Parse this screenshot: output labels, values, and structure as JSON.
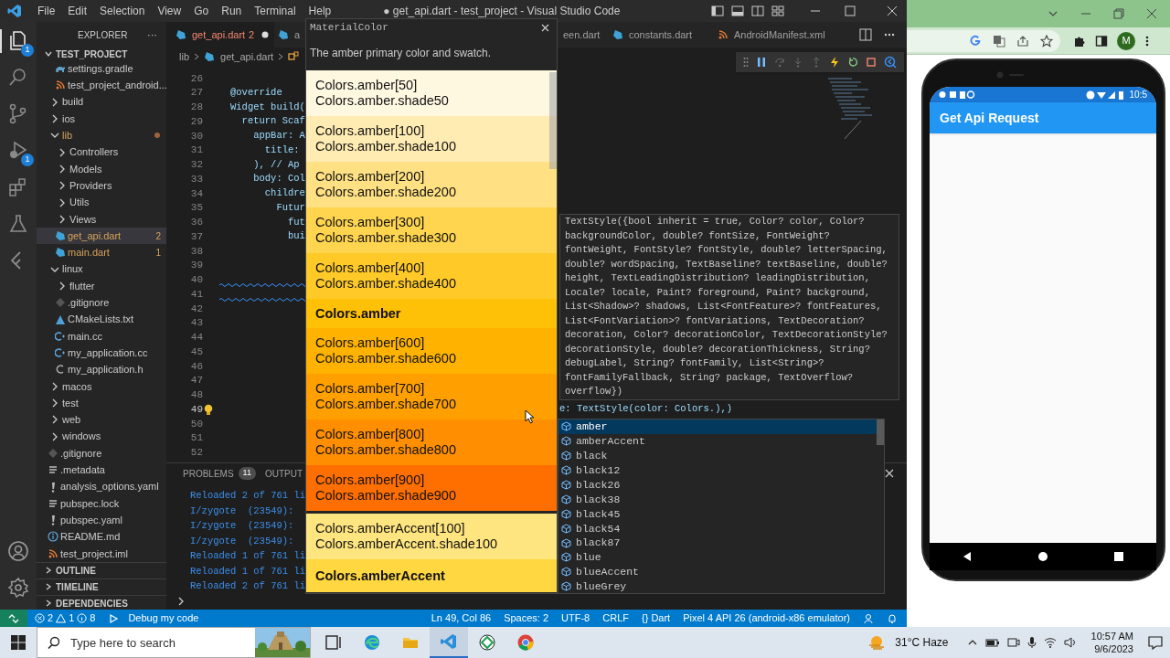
{
  "title_bar": {
    "menu": [
      "File",
      "Edit",
      "Selection",
      "View",
      "Go",
      "Run",
      "Terminal",
      "Help"
    ],
    "title": "● get_api.dart - test_project - Visual Studio Code"
  },
  "activity_bar": {
    "items": [
      {
        "kind": "files",
        "badge": "1",
        "selected": true
      },
      {
        "kind": "search",
        "selected": false
      },
      {
        "kind": "source-control",
        "selected": false
      },
      {
        "kind": "debug",
        "badge": "1",
        "selected": false
      },
      {
        "kind": "extensions",
        "selected": false
      },
      {
        "kind": "testing",
        "selected": false
      },
      {
        "kind": "flutter",
        "selected": false
      }
    ]
  },
  "explorer": {
    "title": "EXPLORER",
    "more": "···",
    "project": "TEST_PROJECT",
    "tree": [
      {
        "kind": "group",
        "children": [
          {
            "label": "settings.gradle",
            "kind": "gradle",
            "modified": false,
            "selected": false
          },
          {
            "label": "test_project_android...",
            "kind": "rss",
            "modified": false,
            "selected": false
          }
        ]
      },
      {
        "label": "build",
        "kind": "folder",
        "expanded": false,
        "modified": false,
        "selected": false
      },
      {
        "label": "ios",
        "kind": "folder",
        "expanded": false,
        "modified": false,
        "selected": false
      },
      {
        "label": "lib",
        "kind": "folder",
        "expanded": true,
        "modified": true,
        "selected": false,
        "children": [
          {
            "label": "Controllers",
            "kind": "folder",
            "expanded": false,
            "modified": false,
            "selected": false
          },
          {
            "label": "Models",
            "kind": "folder",
            "expanded": false,
            "modified": false,
            "selected": false
          },
          {
            "label": "Providers",
            "kind": "folder",
            "expanded": false,
            "modified": false,
            "selected": false
          },
          {
            "label": "Utils",
            "kind": "folder",
            "expanded": false,
            "modified": false,
            "selected": false
          },
          {
            "label": "Views",
            "kind": "folder",
            "expanded": false,
            "modified": false,
            "selected": false
          },
          {
            "label": "get_api.dart",
            "kind": "dart",
            "badge": "2",
            "modified": true,
            "selected": true
          },
          {
            "label": "main.dart",
            "kind": "dart",
            "badge": "1",
            "modified": true,
            "selected": false
          }
        ]
      },
      {
        "label": "linux",
        "kind": "folder",
        "expanded": true,
        "modified": false,
        "selected": false,
        "children": [
          {
            "label": "flutter",
            "kind": "folder",
            "expanded": false,
            "modified": false,
            "selected": false
          },
          {
            "label": ".gitignore",
            "kind": "git",
            "modified": false,
            "selected": false
          },
          {
            "label": "CMakeLists.txt",
            "kind": "cmake",
            "modified": false,
            "selected": false
          },
          {
            "label": "main.cc",
            "kind": "cpp",
            "modified": false,
            "selected": false
          },
          {
            "label": "my_application.cc",
            "kind": "cpp",
            "modified": false,
            "selected": false
          },
          {
            "label": "my_application.h",
            "kind": "c",
            "modified": false,
            "selected": false
          }
        ]
      },
      {
        "label": "macos",
        "kind": "folder",
        "expanded": false,
        "modified": false,
        "selected": false
      },
      {
        "label": "test",
        "kind": "folder",
        "expanded": false,
        "modified": false,
        "selected": false
      },
      {
        "label": "web",
        "kind": "folder",
        "expanded": false,
        "modified": false,
        "selected": false
      },
      {
        "label": "windows",
        "kind": "folder",
        "expanded": false,
        "modified": false,
        "selected": false
      },
      {
        "label": ".gitignore",
        "kind": "git",
        "modified": false,
        "selected": false
      },
      {
        "label": ".metadata",
        "kind": "lines",
        "modified": false,
        "selected": false
      },
      {
        "label": "analysis_options.yaml",
        "kind": "yaml",
        "modified": false,
        "selected": false
      },
      {
        "label": "pubspec.lock",
        "kind": "lines",
        "modified": false,
        "selected": false
      },
      {
        "label": "pubspec.yaml",
        "kind": "yaml",
        "modified": false,
        "selected": false
      },
      {
        "label": "README.md",
        "kind": "info",
        "modified": false,
        "selected": false
      },
      {
        "label": "test_project.iml",
        "kind": "rss",
        "modified": false,
        "selected": false
      }
    ],
    "sections": [
      "OUTLINE",
      "TIMELINE",
      "DEPENDENCIES"
    ]
  },
  "editor": {
    "tabs": [
      {
        "label": "get_api.dart",
        "kind": "dart",
        "badge": "2",
        "modified": true,
        "selected": true
      },
      {
        "label": "a",
        "kind": "dart",
        "modified": false,
        "selected": false
      },
      {
        "label": "een.dart",
        "kind": "none",
        "modified": false,
        "selected": false
      },
      {
        "label": "constants.dart",
        "kind": "dart",
        "modified": false,
        "selected": false
      },
      {
        "label": "AndroidManifest.xml",
        "kind": "rss",
        "modified": false,
        "selected": false
      }
    ],
    "breadcrumb": [
      "lib",
      "get_api.dart"
    ],
    "lines": [
      {
        "n": "26",
        "kind": "plain"
      },
      {
        "n": "27",
        "kind": "plain",
        "text": "@override"
      },
      {
        "n": "28",
        "kind": "plain",
        "text": "Widget build("
      },
      {
        "n": "29",
        "kind": "plain",
        "text": "  return Scaf"
      },
      {
        "n": "30",
        "kind": "plain",
        "text": "    appBar: A"
      },
      {
        "n": "31",
        "kind": "plain",
        "text": "      title:"
      },
      {
        "n": "32",
        "kind": "plain",
        "text": "    ), // Ap"
      },
      {
        "n": "33",
        "kind": "plain",
        "text": "    body: Col"
      },
      {
        "n": "34",
        "kind": "plain",
        "text": "      childre"
      },
      {
        "n": "35",
        "kind": "plain",
        "text": "        Futur"
      },
      {
        "n": "36",
        "kind": "plain",
        "text": "          fut"
      },
      {
        "n": "37",
        "kind": "plain",
        "text": "          bui"
      },
      {
        "n": "38",
        "kind": "plain"
      },
      {
        "n": "39",
        "kind": "plain"
      },
      {
        "n": "40",
        "kind": "squiggle"
      },
      {
        "n": "41",
        "kind": "squiggle"
      },
      {
        "n": "42",
        "kind": "plain"
      },
      {
        "n": "43",
        "kind": "plain"
      },
      {
        "n": "44",
        "kind": "plain"
      },
      {
        "n": "45",
        "kind": "plain"
      },
      {
        "n": "46",
        "kind": "plain"
      },
      {
        "n": "47",
        "kind": "plain"
      },
      {
        "n": "48",
        "kind": "plain"
      },
      {
        "n": "49",
        "kind": "cursor",
        "text": "e: TextStyle(color: Colors.),)"
      },
      {
        "n": "50",
        "kind": "plain"
      },
      {
        "n": "51",
        "kind": "plain"
      },
      {
        "n": "52",
        "kind": "plain"
      }
    ]
  },
  "panel": {
    "tabs": [
      {
        "label": "PROBLEMS",
        "badge": "11",
        "selected": false
      },
      {
        "label": "OUTPUT",
        "selected": false
      }
    ],
    "lines": [
      "Reloaded 2 of 761 li",
      "I/zygote  (23549):",
      "I/zygote  (23549):",
      "I/zygote  (23549):",
      "Reloaded 1 of 761 li",
      "Reloaded 1 of 761 li",
      "Reloaded 2 of 761 li"
    ]
  },
  "hover": {
    "header": "MaterialColor",
    "description": "The amber primary color and swatch.",
    "swatches": [
      {
        "kind": "shade",
        "lines": [
          "Colors.amber[50]",
          "Colors.amber.shade50"
        ],
        "color": "#fff8e1"
      },
      {
        "kind": "shade",
        "lines": [
          "Colors.amber[100]",
          "Colors.amber.shade100"
        ],
        "color": "#ffecb3"
      },
      {
        "kind": "shade",
        "lines": [
          "Colors.amber[200]",
          "Colors.amber.shade200"
        ],
        "color": "#ffe082"
      },
      {
        "kind": "shade",
        "lines": [
          "Colors.amber[300]",
          "Colors.amber.shade300"
        ],
        "color": "#ffd54f"
      },
      {
        "kind": "shade",
        "lines": [
          "Colors.amber[400]",
          "Colors.amber.shade400"
        ],
        "color": "#ffca28"
      },
      {
        "kind": "primary",
        "lines": [
          "Colors.amber"
        ],
        "color": "#ffc107"
      },
      {
        "kind": "shade",
        "lines": [
          "Colors.amber[600]",
          "Colors.amber.shade600"
        ],
        "color": "#ffb300"
      },
      {
        "kind": "shade",
        "lines": [
          "Colors.amber[700]",
          "Colors.amber.shade700"
        ],
        "color": "#ffa000"
      },
      {
        "kind": "shade",
        "lines": [
          "Colors.amber[800]",
          "Colors.amber.shade800"
        ],
        "color": "#ff8f00"
      },
      {
        "kind": "shade",
        "lines": [
          "Colors.amber[900]",
          "Colors.amber.shade900"
        ],
        "color": "#ff6f00"
      },
      {
        "kind": "shade",
        "lines": [
          "Colors.amberAccent[100]",
          "Colors.amberAccent.shade100"
        ],
        "color": "#ffe57f"
      },
      {
        "kind": "primary",
        "lines": [
          "Colors.amberAccent"
        ],
        "color": "#ffd740"
      }
    ]
  },
  "signature": "TextStyle({bool inherit = true, Color? color, Color? backgroundColor, double? fontSize, FontWeight? fontWeight, FontStyle? fontStyle, double? letterSpacing, double? wordSpacing, TextBaseline? textBaseline, double? height, TextLeadingDistribution? leadingDistribution, Locale? locale, Paint? foreground, Paint? background, List<Shadow>? shadows, List<FontFeature>? fontFeatures, List<FontVariation>? fontVariations, TextDecoration? decoration, Color? decorationColor, TextDecorationStyle? decorationStyle, double? decorationThickness, String? debugLabel, String? fontFamily, List<String>? fontFamilyFallback, String? package, TextOverflow? overflow})",
  "suggestions": [
    {
      "label": "amber",
      "selected": true
    },
    {
      "label": "amberAccent",
      "selected": false
    },
    {
      "label": "black",
      "selected": false
    },
    {
      "label": "black12",
      "selected": false
    },
    {
      "label": "black26",
      "selected": false
    },
    {
      "label": "black38",
      "selected": false
    },
    {
      "label": "black45",
      "selected": false
    },
    {
      "label": "black54",
      "selected": false
    },
    {
      "label": "black87",
      "selected": false
    },
    {
      "label": "blue",
      "selected": false
    },
    {
      "label": "blueAccent",
      "selected": false
    },
    {
      "label": "blueGrey",
      "selected": false
    }
  ],
  "status_bar": {
    "errors": "2",
    "warnings": "1",
    "infos": "8",
    "debug": "Debug my code",
    "right": [
      "Ln 49, Col 86",
      "Spaces: 2",
      "UTF-8",
      "CRLF",
      "{} Dart",
      "Pixel 4 API 26 (android-x86 emulator)"
    ]
  },
  "browser": {
    "profile": "M",
    "phone": {
      "time": "10:5",
      "app_title": "Get Api Request"
    }
  },
  "taskbar": {
    "search": {
      "placeholder": "Type here to search"
    },
    "apps": [
      {
        "kind": "task-view",
        "selected": false
      },
      {
        "kind": "edge",
        "selected": false
      },
      {
        "kind": "explorer",
        "selected": false
      },
      {
        "kind": "vscode",
        "selected": true
      },
      {
        "kind": "app",
        "selected": false
      },
      {
        "kind": "chrome",
        "selected": false
      }
    ],
    "weather": "31°C Haze",
    "time": "10:57 AM",
    "date": "9/6/2023"
  }
}
